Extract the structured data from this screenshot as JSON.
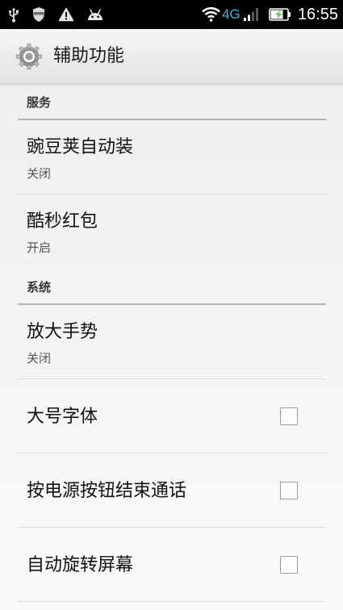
{
  "status_bar": {
    "left_icons": [
      "usb-icon",
      "shield-icon",
      "warning-icon",
      "android-icon"
    ],
    "right_icons": [
      "wifi-icon",
      "signal-strength-icon",
      "battery-charging-icon"
    ],
    "network_type": "4G",
    "signal_level": 2,
    "signal_max": 4,
    "battery_level": 0.75,
    "battery_charging": true,
    "time": "16:55"
  },
  "action_bar": {
    "icon": "settings-gear-icon",
    "title": "辅助功能"
  },
  "sections": [
    {
      "header": "服务",
      "items": [
        {
          "title": "豌豆荚自动装",
          "summary": "关闭"
        },
        {
          "title": "酷秒红包",
          "summary": "开启"
        }
      ]
    },
    {
      "header": "系统",
      "items": [
        {
          "title": "放大手势",
          "summary": "关闭"
        },
        {
          "title": "大号字体",
          "checked": false
        },
        {
          "title": "按电源按钮结束通话",
          "checked": false
        },
        {
          "title": "自动旋转屏幕",
          "checked": false
        }
      ]
    }
  ],
  "colors": {
    "status_bar_bg": "#000000",
    "network_accent": "#33b5e5",
    "battery_bolt": "#5cc23a",
    "category_divider": "#b4b4b4",
    "title_text": "#111111",
    "summary_text": "#555555"
  }
}
